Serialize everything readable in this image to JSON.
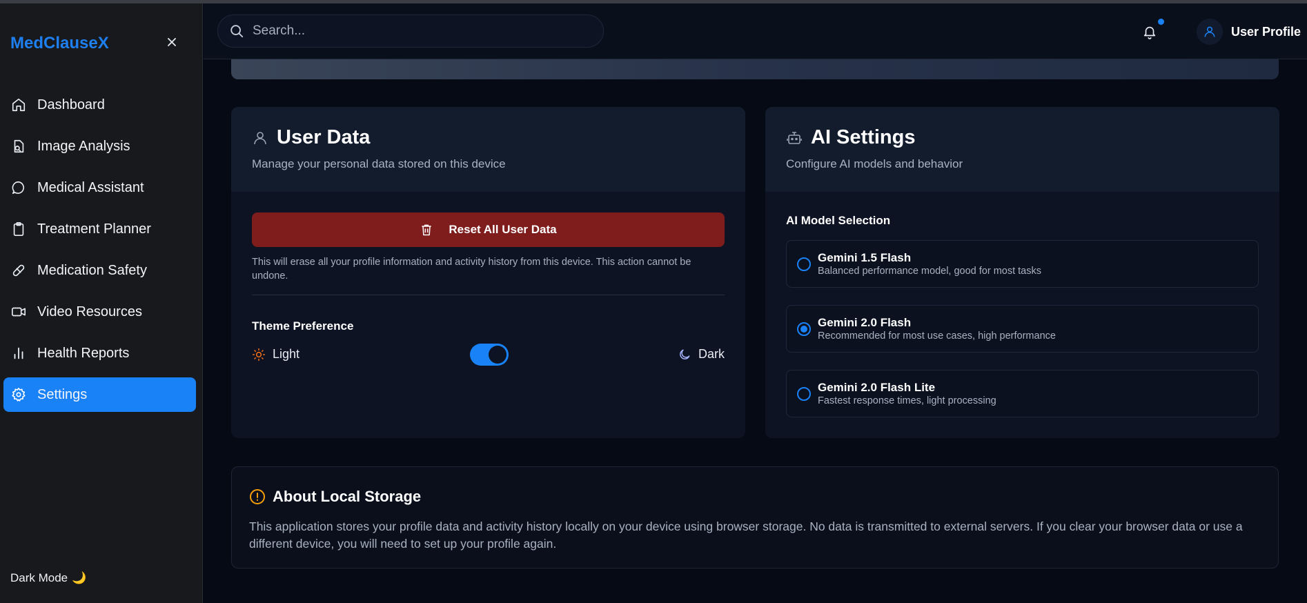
{
  "app": {
    "brand": "MedClauseX"
  },
  "sidebar": {
    "items": [
      {
        "label": "Dashboard",
        "icon": "home-icon"
      },
      {
        "label": "Image Analysis",
        "icon": "file-search-icon"
      },
      {
        "label": "Medical Assistant",
        "icon": "chat-bubble-icon"
      },
      {
        "label": "Treatment Planner",
        "icon": "clipboard-icon"
      },
      {
        "label": "Medication Safety",
        "icon": "pill-icon"
      },
      {
        "label": "Video Resources",
        "icon": "video-icon"
      },
      {
        "label": "Health Reports",
        "icon": "bar-chart-icon"
      },
      {
        "label": "Settings",
        "icon": "gear-icon",
        "active": true
      }
    ],
    "footer_label": "Dark Mode",
    "footer_emoji": "🌙"
  },
  "header": {
    "search_placeholder": "Search...",
    "profile_label": "User Profile",
    "has_notification": true
  },
  "user_data": {
    "title": "User Data",
    "subtitle": "Manage your personal data stored on this device",
    "reset_label": "Reset All User Data",
    "reset_note": "This will erase all your profile information and activity history from this device. This action cannot be undone.",
    "theme_label": "Theme Preference",
    "light_label": "Light",
    "dark_label": "Dark",
    "theme_selected": "Dark"
  },
  "ai_settings": {
    "title": "AI Settings",
    "subtitle": "Configure AI models and behavior",
    "selection_label": "AI Model Selection",
    "models": [
      {
        "name": "Gemini 1.5 Flash",
        "desc": "Balanced performance model, good for most tasks",
        "selected": false
      },
      {
        "name": "Gemini 2.0 Flash",
        "desc": "Recommended for most use cases, high performance",
        "selected": true
      },
      {
        "name": "Gemini 2.0 Flash Lite",
        "desc": "Fastest response times, light processing",
        "selected": false
      }
    ]
  },
  "about": {
    "title": "About Local Storage",
    "text": "This application stores your profile data and activity history locally on your device using browser storage. No data is transmitted to external servers. If you clear your browser data or use a different device, you will need to set up your profile again."
  },
  "colors": {
    "accent": "#1a82f7",
    "danger": "#7f1d1d",
    "warning": "#f59e0b"
  }
}
